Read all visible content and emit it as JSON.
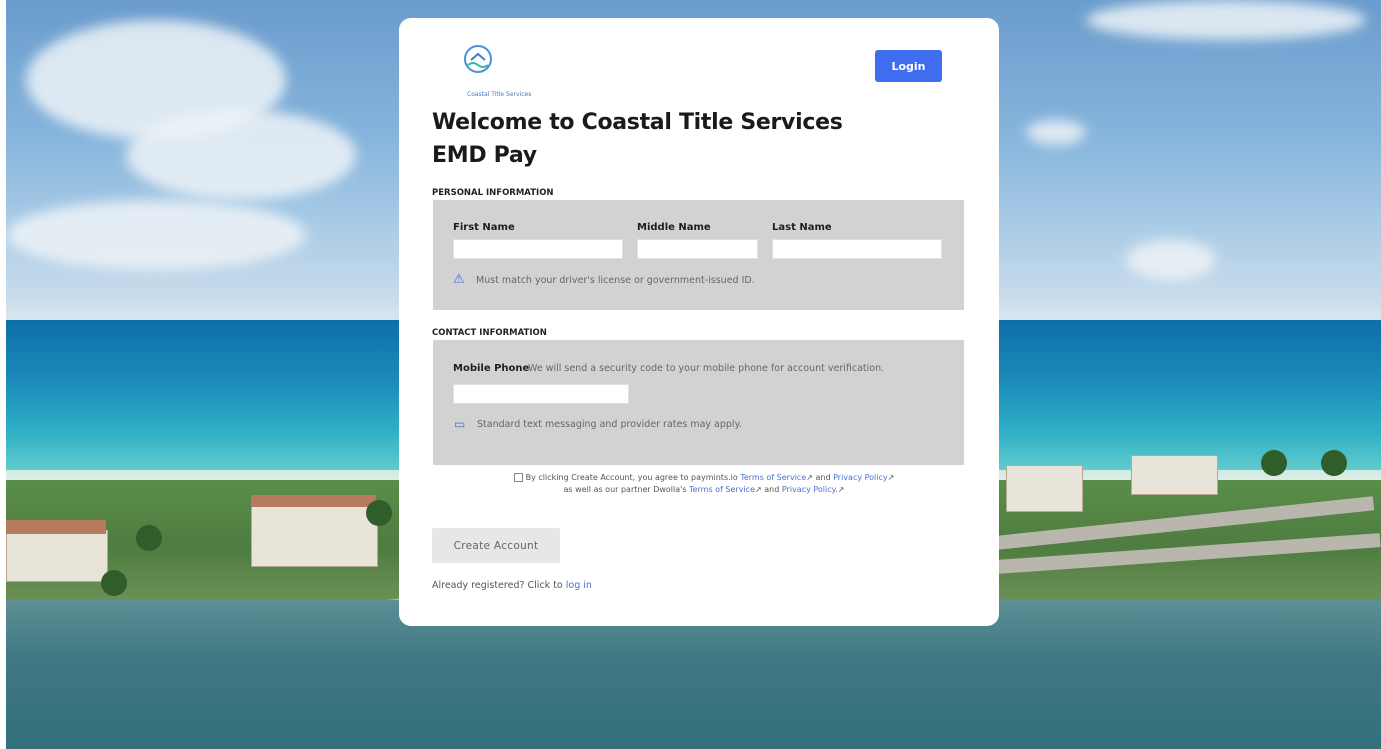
{
  "brand": {
    "logo_text": "Coastal Title Services"
  },
  "header": {
    "login_label": "Login"
  },
  "title": {
    "line1": "Welcome to Coastal Title Services",
    "line2": "EMD Pay"
  },
  "personal": {
    "section_label": "PERSONAL INFORMATION",
    "first_name_label": "First Name",
    "middle_name_label": "Middle Name",
    "last_name_label": "Last Name",
    "first_name_value": "",
    "middle_name_value": "",
    "last_name_value": "",
    "note": "Must match your driver's license or government-issued ID."
  },
  "contact": {
    "section_label": "CONTACT INFORMATION",
    "mobile_label": "Mobile Phone",
    "mobile_help": "We will send a security code to your mobile phone for account verification.",
    "mobile_value": "",
    "note": "Standard text messaging and provider rates may apply."
  },
  "terms": {
    "prefix": "By clicking Create Account, you agree to paymints.io",
    "tos_link": "Terms of Service",
    "and1": "and",
    "privacy_link": "Privacy Policy",
    "middle": "as well as our partner Dwolla's",
    "dwolla_tos_link": "Terms of Service",
    "and2": "and",
    "dwolla_privacy_link": "Privacy Policy."
  },
  "actions": {
    "create_label": "Create Account",
    "already_text": "Already registered? Click to",
    "login_link": "log in"
  },
  "colors": {
    "primary": "#3f6df0",
    "panel": "#d2d2d2",
    "link": "#4a6fd6"
  }
}
